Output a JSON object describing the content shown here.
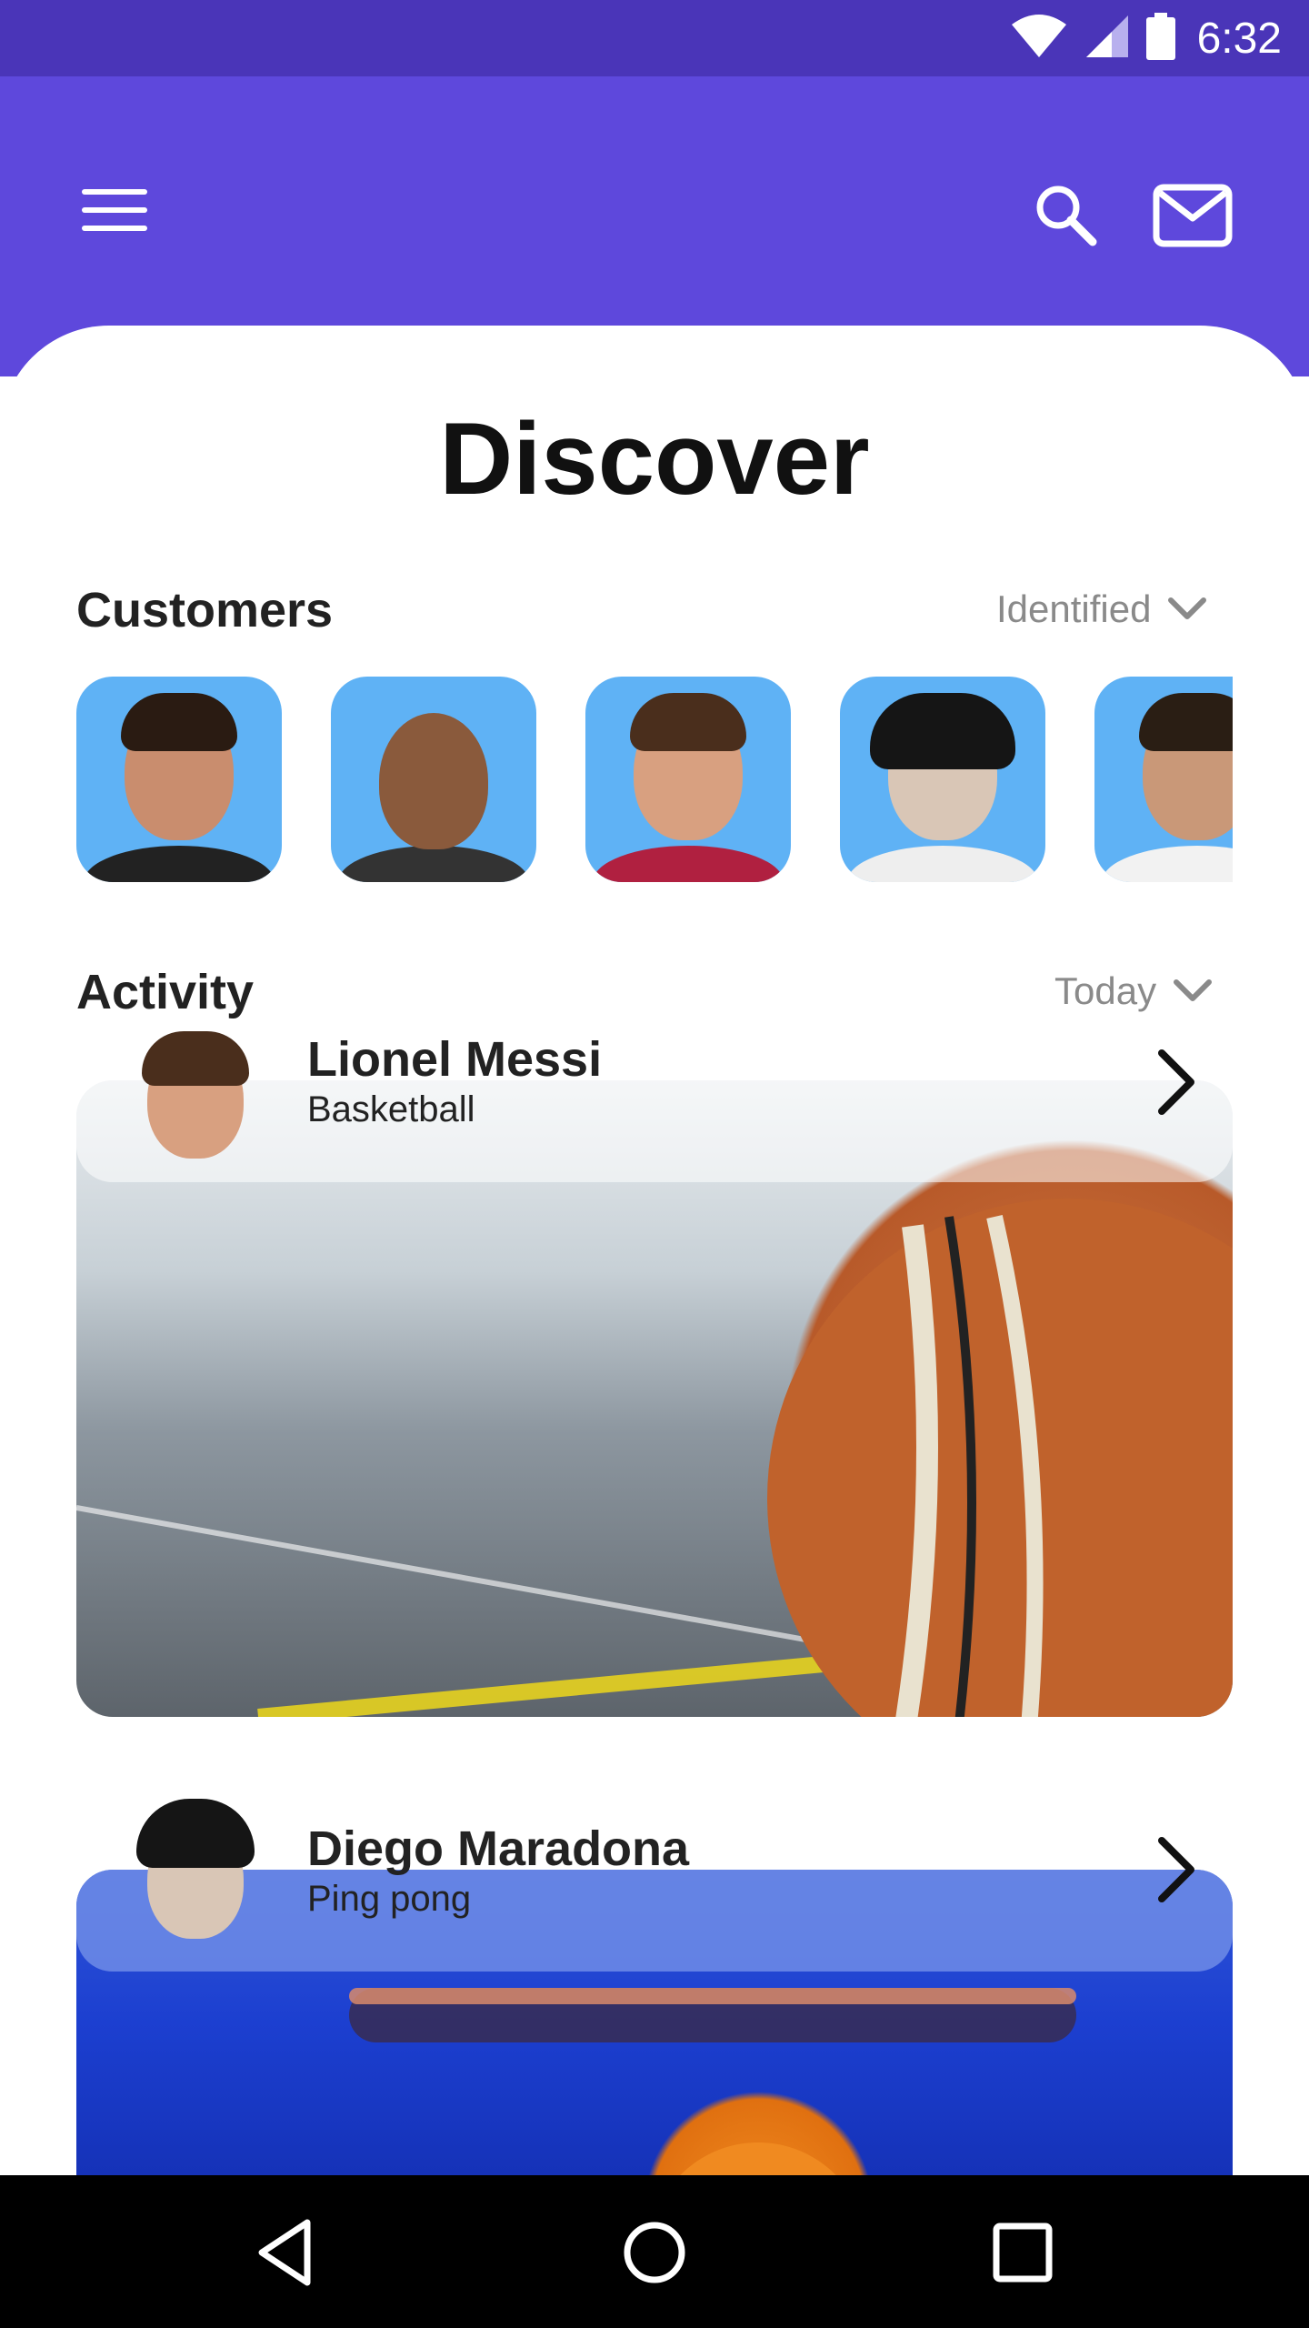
{
  "status_bar": {
    "time": "6:32",
    "icons": [
      "wifi-icon",
      "signal-icon",
      "battery-icon"
    ]
  },
  "app_bar": {
    "menu_icon": "hamburger-menu-icon",
    "search_icon": "search-icon",
    "mail_icon": "mail-icon",
    "color": "#5e48dc"
  },
  "page": {
    "title": "Discover"
  },
  "customers": {
    "title": "Customers",
    "filter_label": "Identified",
    "avatars": [
      {
        "name": "customer-1"
      },
      {
        "name": "customer-2"
      },
      {
        "name": "customer-3"
      },
      {
        "name": "customer-4"
      },
      {
        "name": "customer-5"
      }
    ]
  },
  "activity": {
    "title": "Activity",
    "filter_label": "Today",
    "items": [
      {
        "name": "Lionel Messi",
        "sport": "Basketball"
      },
      {
        "name": "Diego Maradona",
        "sport": "Ping pong"
      }
    ]
  },
  "nav_bar": {
    "back_icon": "back-triangle-icon",
    "home_icon": "home-circle-icon",
    "recents_icon": "recents-square-icon"
  }
}
